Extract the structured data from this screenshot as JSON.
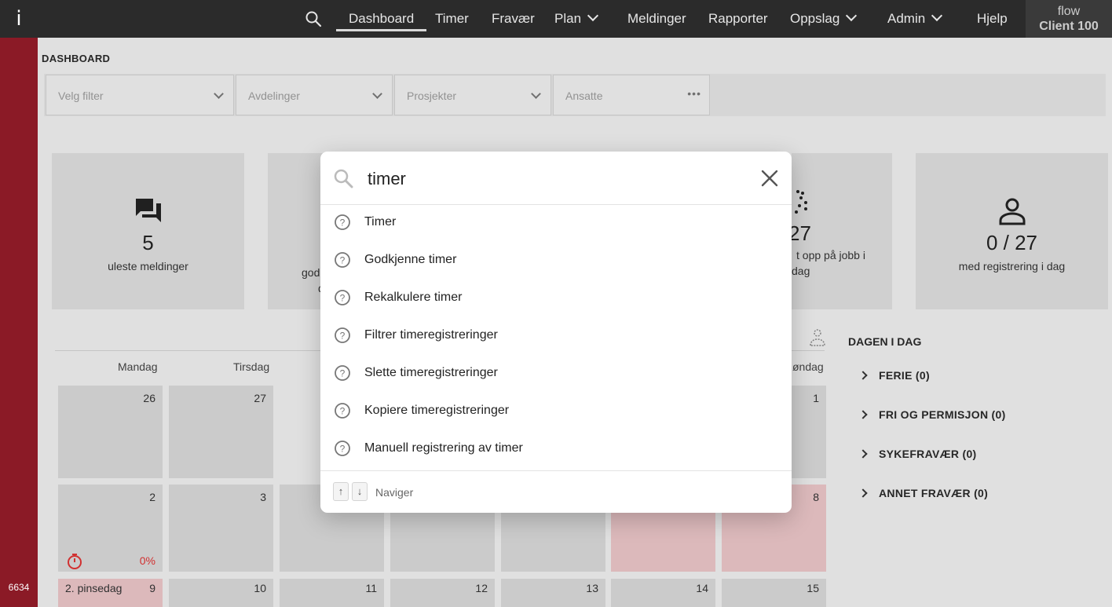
{
  "app": {
    "logo": "i",
    "version": "6634",
    "client_line1": "flow",
    "client_line2": "Client 100"
  },
  "nav": {
    "items": [
      {
        "label": "Dashboard",
        "active": true
      },
      {
        "label": "Timer"
      },
      {
        "label": "Fravær"
      },
      {
        "label": "Plan",
        "dropdown": true
      },
      {
        "label": "Meldinger"
      },
      {
        "label": "Rapporter"
      },
      {
        "label": "Oppslag",
        "dropdown": true
      },
      {
        "label": "Admin",
        "dropdown": true
      },
      {
        "label": "Hjelp"
      }
    ]
  },
  "page": {
    "title": "DASHBOARD"
  },
  "filters": {
    "velg_filter": "Velg filter",
    "avdelinger": "Avdelinger",
    "prosjekter": "Prosjekter",
    "ansatte": "Ansatte"
  },
  "cards": [
    {
      "value": "5",
      "label": "uleste meldinger",
      "icon": "chat-icon"
    },
    {
      "value": "",
      "label_partial_1": "god",
      "label_partial_2": "d",
      "icon": ""
    },
    {
      "value": "27",
      "label_partial_1": "t opp på jobb i",
      "label_partial_2": "dag",
      "icon": "dots-person-icon"
    },
    {
      "value": "0 / 27",
      "label": "med registrering i dag",
      "icon": "person-icon"
    }
  ],
  "calendar": {
    "weekdays": [
      "Mandag",
      "Tirsdag",
      "øndag"
    ],
    "week1": [
      "26",
      "27",
      "1"
    ],
    "week2": [
      "2",
      "3",
      "8"
    ],
    "week2_pct": "0%",
    "week3": [
      "9",
      "10",
      "11",
      "12",
      "13",
      "14",
      "15"
    ],
    "holiday": "2. pinsedag"
  },
  "today": {
    "title": "DAGEN I DAG",
    "items": [
      "FERIE (0)",
      "FRI OG PERMISJON (0)",
      "SYKEFRAVÆR (0)",
      "ANNET FRAVÆR (0)"
    ]
  },
  "search_modal": {
    "query": "timer",
    "results": [
      "Timer",
      "Godkjenne timer",
      "Rekalkulere timer",
      "Filtrer timeregistreringer",
      "Slette timeregistreringer",
      "Kopiere timeregistreringer",
      "Manuell registrering av timer"
    ],
    "key_up": "↑",
    "key_down": "↓",
    "nav_hint": "Naviger"
  },
  "colors": {
    "rail": "#8b1a26",
    "topbar": "#2b2b2b",
    "holiday_cell": "#e8c3c6",
    "percent_red": "#dd3333"
  }
}
